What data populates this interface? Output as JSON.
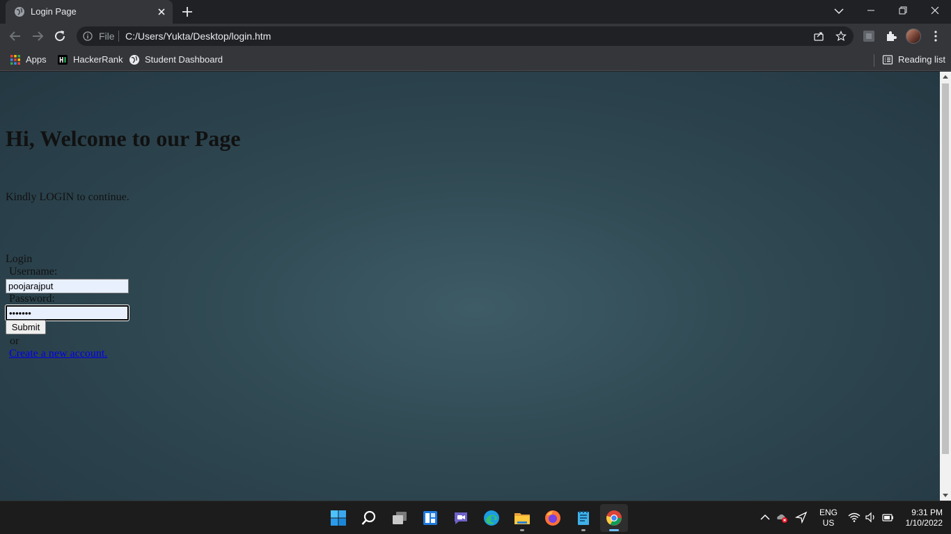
{
  "browser": {
    "tab_title": "Login Page",
    "url_scheme": "File",
    "url": "C:/Users/Yukta/Desktop/login.htm"
  },
  "bookmarks": {
    "items": [
      {
        "label": "Apps",
        "icon": "apps-grid-icon"
      },
      {
        "label": "HackerRank",
        "icon": "hackerrank-icon"
      },
      {
        "label": "Student Dashboard",
        "icon": "globe-icon"
      }
    ],
    "reading_list": "Reading list"
  },
  "page": {
    "heading": "Hi, Welcome to our Page",
    "subtitle": "Kindly LOGIN to continue.",
    "form_title": "Login",
    "username_label": "Username:",
    "username_value": "poojarajput",
    "password_label": "Password:",
    "password_value": "•••••••",
    "submit_label": "Submit",
    "or_text": "or",
    "create_account_link": "Create a new account."
  },
  "taskbar": {
    "apps": [
      "windows-start",
      "search",
      "task-view",
      "widgets",
      "teams-chat",
      "edge",
      "file-explorer",
      "firefox",
      "notepad",
      "chrome"
    ],
    "language_line1": "ENG",
    "language_line2": "US",
    "time": "9:31 PM",
    "date": "1/10/2022"
  },
  "colors": {
    "page_background": "#2f4852",
    "link": "#0000ee",
    "chrome_frame": "#202124",
    "chrome_toolbar": "#35363a"
  }
}
